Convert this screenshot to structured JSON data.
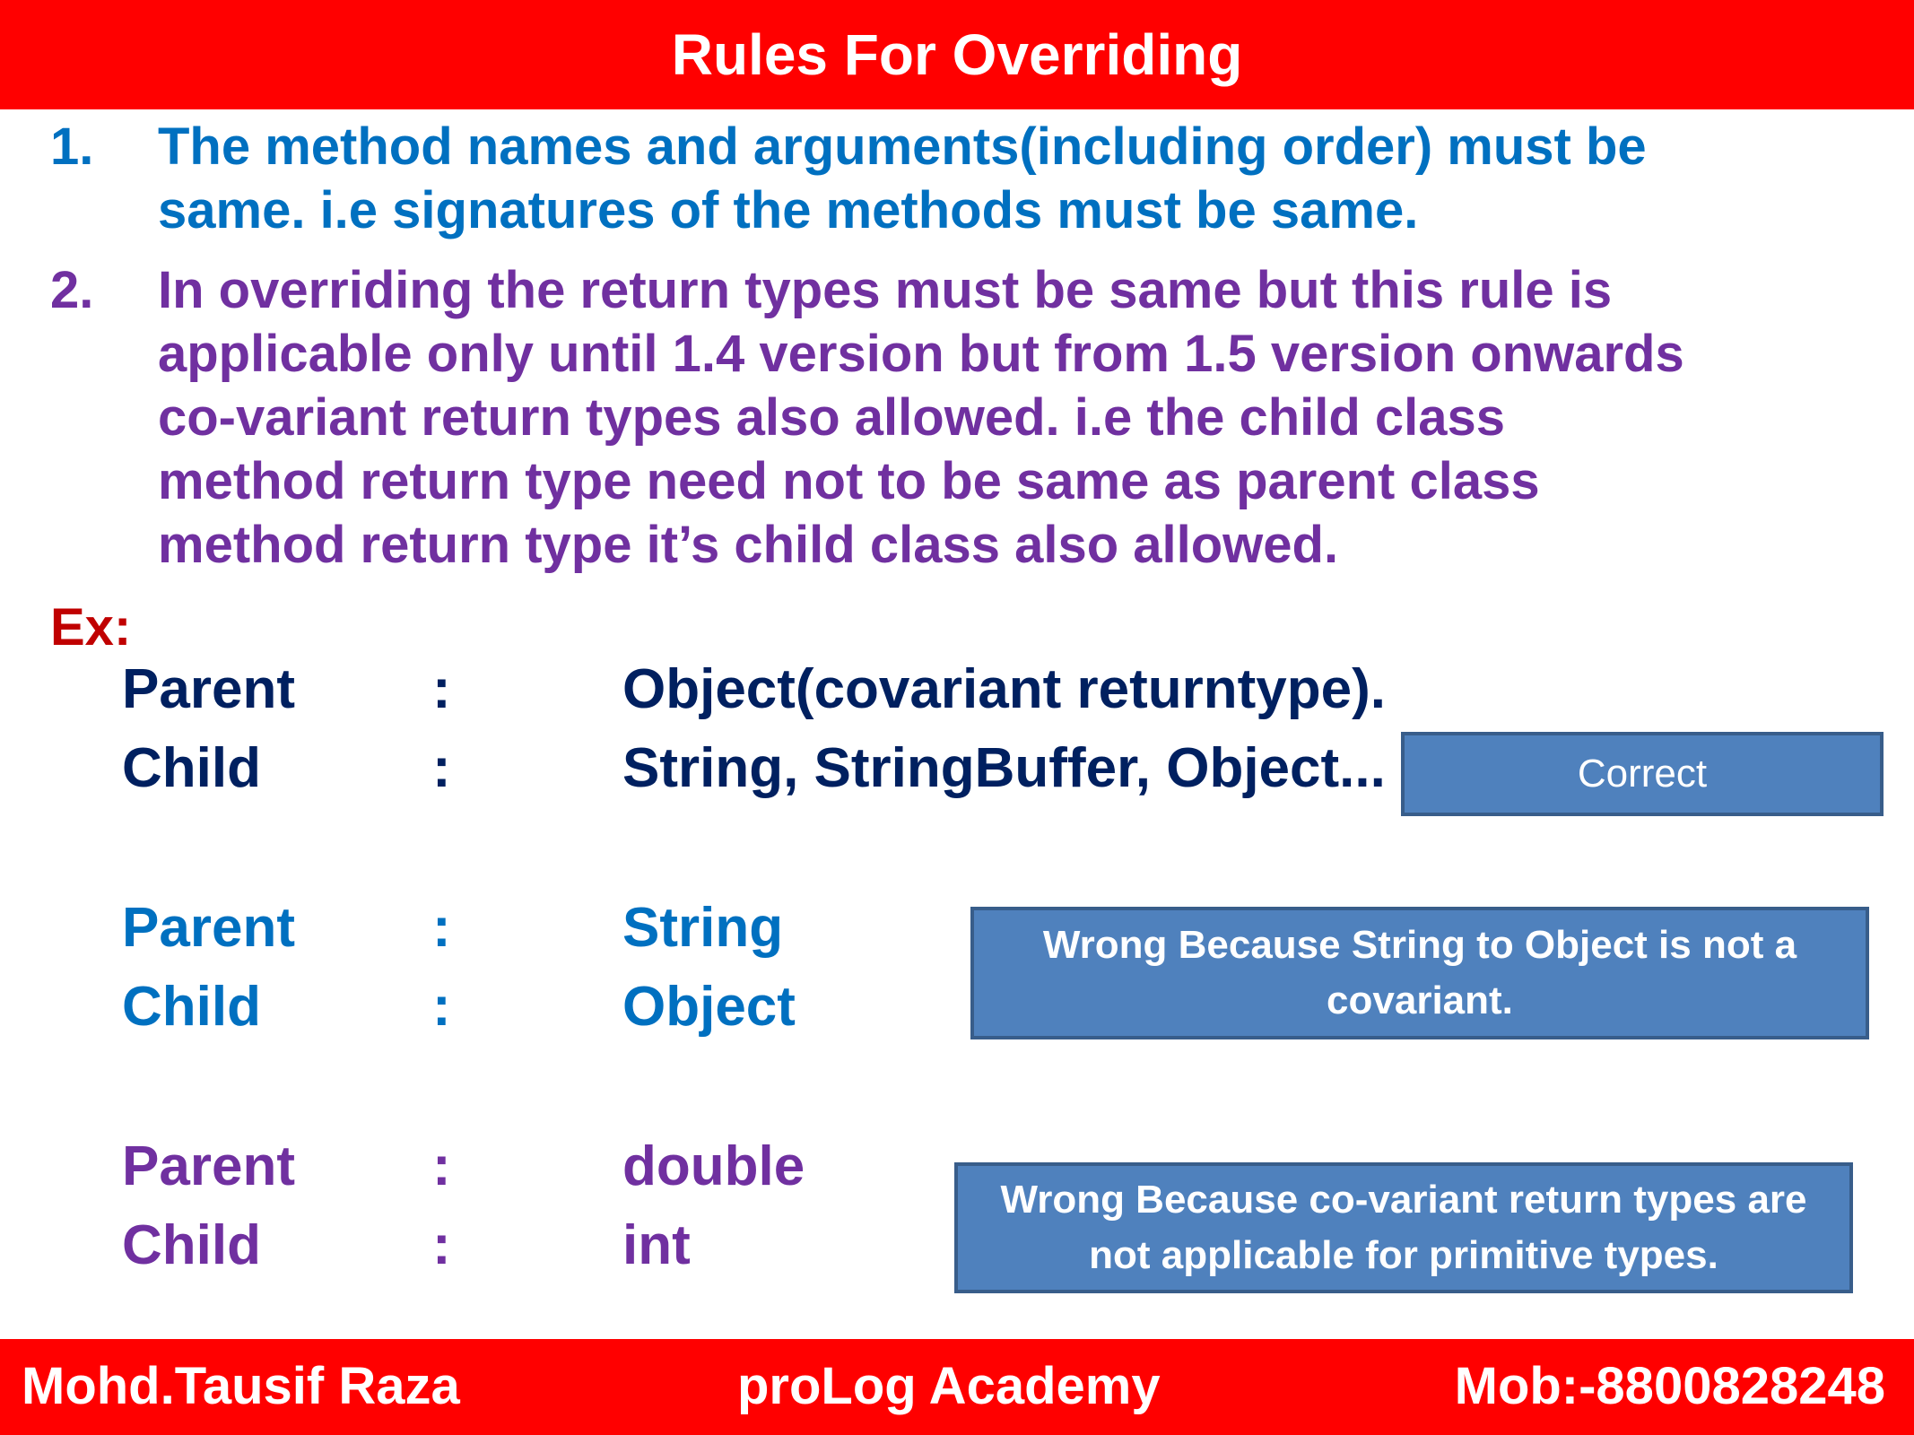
{
  "header": {
    "title": "Rules For Overriding"
  },
  "rules": [
    {
      "number": "1.",
      "lines": [
        "The method names and arguments(including order) must be",
        "same. i.e signatures of the methods must be same."
      ]
    },
    {
      "number": "2.",
      "lines": [
        "In overriding the return types must be same but this rule is",
        "applicable only until 1.4 version but from 1.5 version onwards",
        "co-variant return types also allowed. i.e the child class",
        "method return type need not to be same as parent class",
        "method return type it’s child class also allowed."
      ]
    }
  ],
  "example": {
    "label": "Ex:",
    "groups": [
      {
        "rows": [
          {
            "key": "Parent",
            "sep": ":",
            "value": "Object(covariant returntype)."
          },
          {
            "key": "Child",
            "sep": ":",
            "value": "String, StringBuffer, Object..."
          }
        ],
        "note": {
          "lines": [
            "Correct"
          ]
        },
        "color": "#002060"
      },
      {
        "rows": [
          {
            "key": "Parent",
            "sep": ":",
            "value": "String"
          },
          {
            "key": "Child",
            "sep": ":",
            "value": "Object"
          }
        ],
        "note": {
          "lines": [
            "Wrong  Because String to Object is not a",
            "covariant."
          ]
        },
        "color": "#0070c0"
      },
      {
        "rows": [
          {
            "key": "Parent",
            "sep": ":",
            "value": "double"
          },
          {
            "key": "Child",
            "sep": ":",
            "value": "int"
          }
        ],
        "note": {
          "lines": [
            "Wrong Because co-variant return types are",
            "not applicable for primitive types."
          ]
        },
        "color": "#7030a0"
      }
    ]
  },
  "footer": {
    "author": "Mohd.Tausif Raza",
    "academy": "proLog Academy",
    "mobile": "Mob:-8800828248"
  },
  "colors": {
    "header_bg": "#ff0000",
    "note_bg": "#4f81bd",
    "note_border": "#385d8a",
    "rule1": "#0070c0",
    "rule2": "#7030a0",
    "ex_label": "#c00000"
  }
}
